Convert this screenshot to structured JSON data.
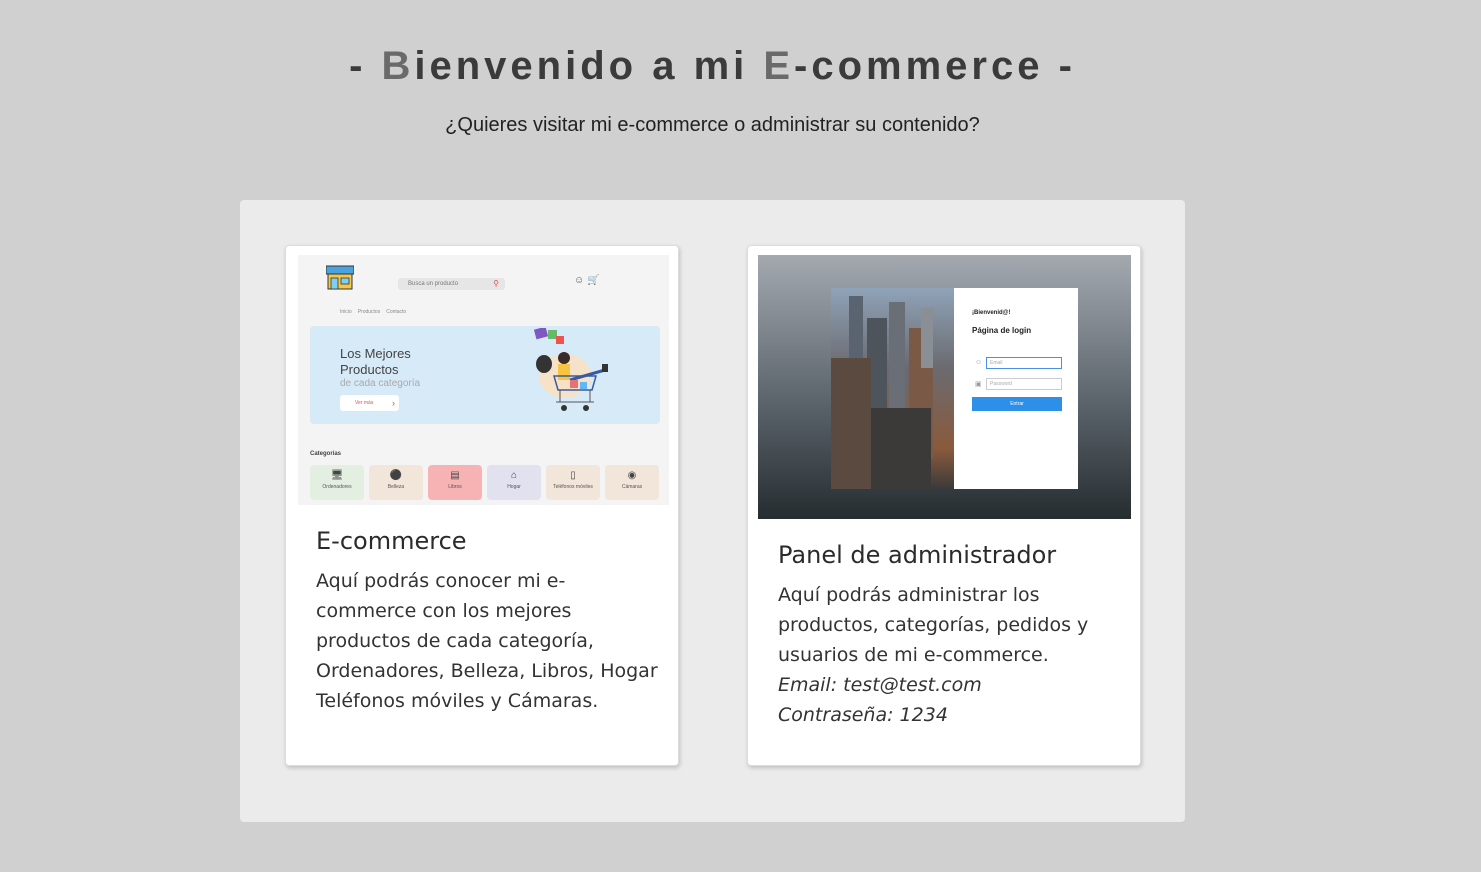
{
  "header": {
    "title_parts": [
      "- ",
      "B",
      "ienvenido a mi ",
      "E",
      "-commerce -"
    ],
    "subtitle": "¿Quieres visitar mi e-commerce o administrar su contenido?"
  },
  "cards": [
    {
      "title": "E-commerce",
      "text": "Aquí podrás conocer mi e-commerce con los mejores productos de cada categoría, Ordenadores, Belleza, Libros, Hogar Teléfonos móviles y Cámaras.",
      "preview": {
        "search_placeholder": "Busca un producto",
        "cart_count": "0",
        "menu": [
          "Inicio",
          "Productos",
          "Contacto"
        ],
        "banner_line1": "Los Mejores",
        "banner_line2": "Productos",
        "banner_line3": "de cada categoría",
        "banner_button": "Ver más",
        "categories_title": "Categorías",
        "categories": [
          {
            "label": "Ordenadores",
            "icon": "monitor-icon",
            "color": "#e3efe1"
          },
          {
            "label": "Belleza",
            "icon": "palette-icon",
            "color": "#f1e6d9"
          },
          {
            "label": "Libros",
            "icon": "book-icon",
            "color": "#f7b3b3"
          },
          {
            "label": "Hogar",
            "icon": "home-icon",
            "color": "#e1e1f0"
          },
          {
            "label": "Teléfonos móviles",
            "icon": "phone-icon",
            "color": "#f1e6d9"
          },
          {
            "label": "Cámaras",
            "icon": "camera-icon",
            "color": "#f1e6d9"
          }
        ]
      }
    },
    {
      "title": "Panel de administrador",
      "text": "Aquí podrás administrar los productos, categorías, pedidos y usuarios de mi e-commerce.",
      "email_line": "Email: test@test.com",
      "password_line": "Contraseña: 1234",
      "preview": {
        "greeting": "¡Bienvenid@!",
        "heading": "Página de login",
        "email_placeholder": "Email",
        "password_placeholder": "Password",
        "button": "Entrar"
      }
    }
  ],
  "colors": {
    "background": "#d0d0d0",
    "panel": "#ebebeb",
    "card": "#ffffff",
    "login_button": "#2d8fe8"
  }
}
